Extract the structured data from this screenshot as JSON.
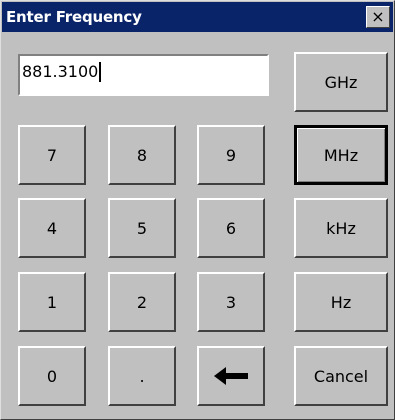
{
  "window": {
    "title": "Enter Frequency",
    "close_glyph": "×"
  },
  "input": {
    "value": "881.3100"
  },
  "keypad": {
    "rows": [
      [
        "7",
        "8",
        "9"
      ],
      [
        "4",
        "5",
        "6"
      ],
      [
        "1",
        "2",
        "3"
      ],
      [
        "0",
        ".",
        "backspace"
      ]
    ],
    "backspace_icon": "left-arrow-icon"
  },
  "units": {
    "ghz": "GHz",
    "mhz": "MHz",
    "khz": "kHz",
    "hz": "Hz",
    "cancel": "Cancel",
    "focused": "MHz"
  }
}
